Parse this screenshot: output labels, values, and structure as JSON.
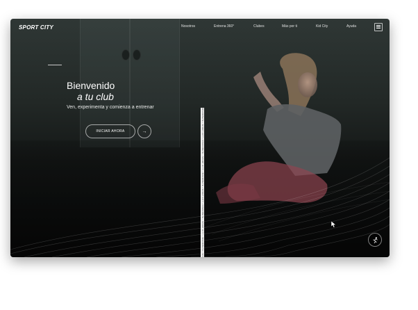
{
  "header": {
    "logo": "SPORT CITY",
    "nav": [
      "Nosotros",
      "Entrena 360°",
      "Clubes",
      "Más por ti",
      "Kid City",
      "Ayuda"
    ]
  },
  "hero": {
    "title_line1": "Bienvenido",
    "title_line2": "a tu club",
    "subtitle": "Ven, experimenta y comienza a entrenar",
    "cta_label": "INICIAR AHORA"
  },
  "ticker": {
    "text": "INSCRIBETE • SPORT CITY • INSCRIBETE • SPORT CITY • INSCRIBETE • SPORT CITY • INSCRIBETE • SPORT CITY • INSCRIBETE • SPORT CITY • INSCRIBETE • SPORT CITY"
  },
  "icons": {
    "menu": "hamburger-icon",
    "cta_arrow": "arrow-right-icon",
    "fab": "running-person-icon",
    "cursor": "mouse-cursor-icon"
  },
  "colors": {
    "background_top": "#2f3735",
    "background_bottom": "#0b0c0c",
    "text": "#ffffff",
    "accent_pink": "#c0606a"
  }
}
